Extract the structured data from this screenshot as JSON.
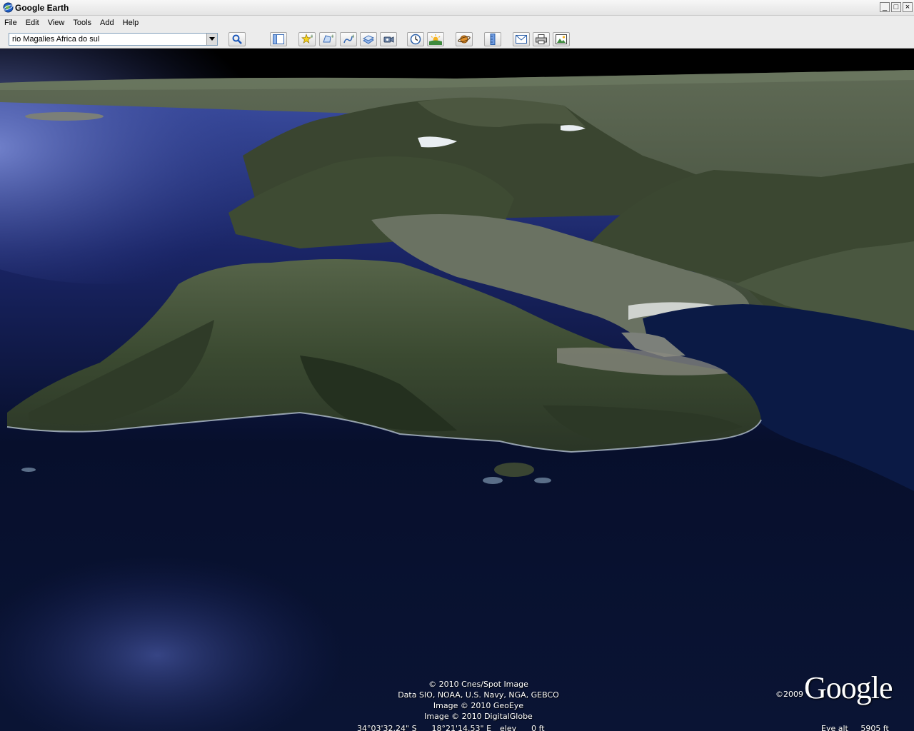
{
  "window": {
    "title": "Google Earth",
    "title_icon": "google-earth-globe-icon",
    "controls": {
      "minimize": "_",
      "maximize": "□",
      "close": "×"
    }
  },
  "menu": {
    "items": [
      "File",
      "Edit",
      "View",
      "Tools",
      "Add",
      "Help"
    ]
  },
  "toolbar": {
    "search_value": "rio Magalies Africa do sul",
    "search_dropdown_icon": "chevron-down-icon",
    "buttons": [
      "search-icon",
      "sidebar-toggle-icon",
      "placemark-icon",
      "polygon-icon",
      "path-icon",
      "image-overlay-icon",
      "record-tour-icon",
      "historical-imagery-icon",
      "sunlight-icon",
      "planets-icon",
      "ruler-icon",
      "email-icon",
      "print-icon",
      "save-image-icon"
    ]
  },
  "map": {
    "attribution": [
      "© 2010 Cnes/Spot Image",
      "Data SIO, NOAA, U.S. Navy, NGA, GEBCO",
      "Image © 2010 GeoEye",
      "Image © 2010 DigitalGlobe"
    ],
    "logo_year": "©2009",
    "logo_text": "Google",
    "status": {
      "coords": "34°03'32.24\" S      18°21'14.53\" E",
      "elevation": "elev      0 ft",
      "eye_alt": "Eye alt     5905 ft"
    }
  },
  "colors": {
    "ocean_deep": "#060d28",
    "ocean_light": "#3a4c9a",
    "land_green": "#3d4a30",
    "sky": "#000000"
  }
}
